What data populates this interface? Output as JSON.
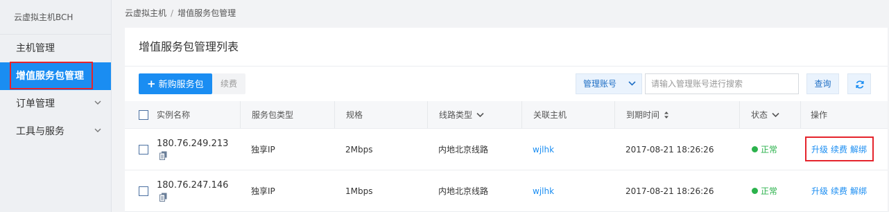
{
  "sidebar": {
    "title": "云虚拟主机BCH",
    "items": [
      {
        "label": "主机管理"
      },
      {
        "label": "增值服务包管理"
      },
      {
        "label": "订单管理"
      },
      {
        "label": "工具与服务"
      }
    ]
  },
  "breadcrumb": {
    "root": "云虚拟主机",
    "sep": "/",
    "current": "增值服务包管理"
  },
  "panel": {
    "title": "增值服务包管理列表"
  },
  "toolbar": {
    "new_label": "新购服务包",
    "renew_label": "续费",
    "select_label": "管理账号",
    "search_placeholder": "请输入管理账号进行搜索",
    "query_label": "查询"
  },
  "table": {
    "columns": [
      "实例名称",
      "服务包类型",
      "规格",
      "线路类型",
      "关联主机",
      "到期时间",
      "状态",
      "操作"
    ],
    "rows": [
      {
        "ip": "180.76.249.213",
        "type": "独享IP",
        "spec": "2Mbps",
        "line": "内地北京线路",
        "host": "wjlhk",
        "expire": "2017-08-21 18:26:26",
        "status": "正常",
        "ops": [
          "升级",
          "续费",
          "解绑"
        ]
      },
      {
        "ip": "180.76.247.146",
        "type": "独享IP",
        "spec": "1Mbps",
        "line": "内地北京线路",
        "host": "wjlhk",
        "expire": "2017-08-21 18:26:26",
        "status": "正常",
        "ops": [
          "升级",
          "续费",
          "解绑"
        ]
      }
    ]
  },
  "colors": {
    "primary": "#1a8df2",
    "active_sidebar": "#1a8df2",
    "status_ok": "#2bb24c",
    "highlight": "#e5232b"
  }
}
